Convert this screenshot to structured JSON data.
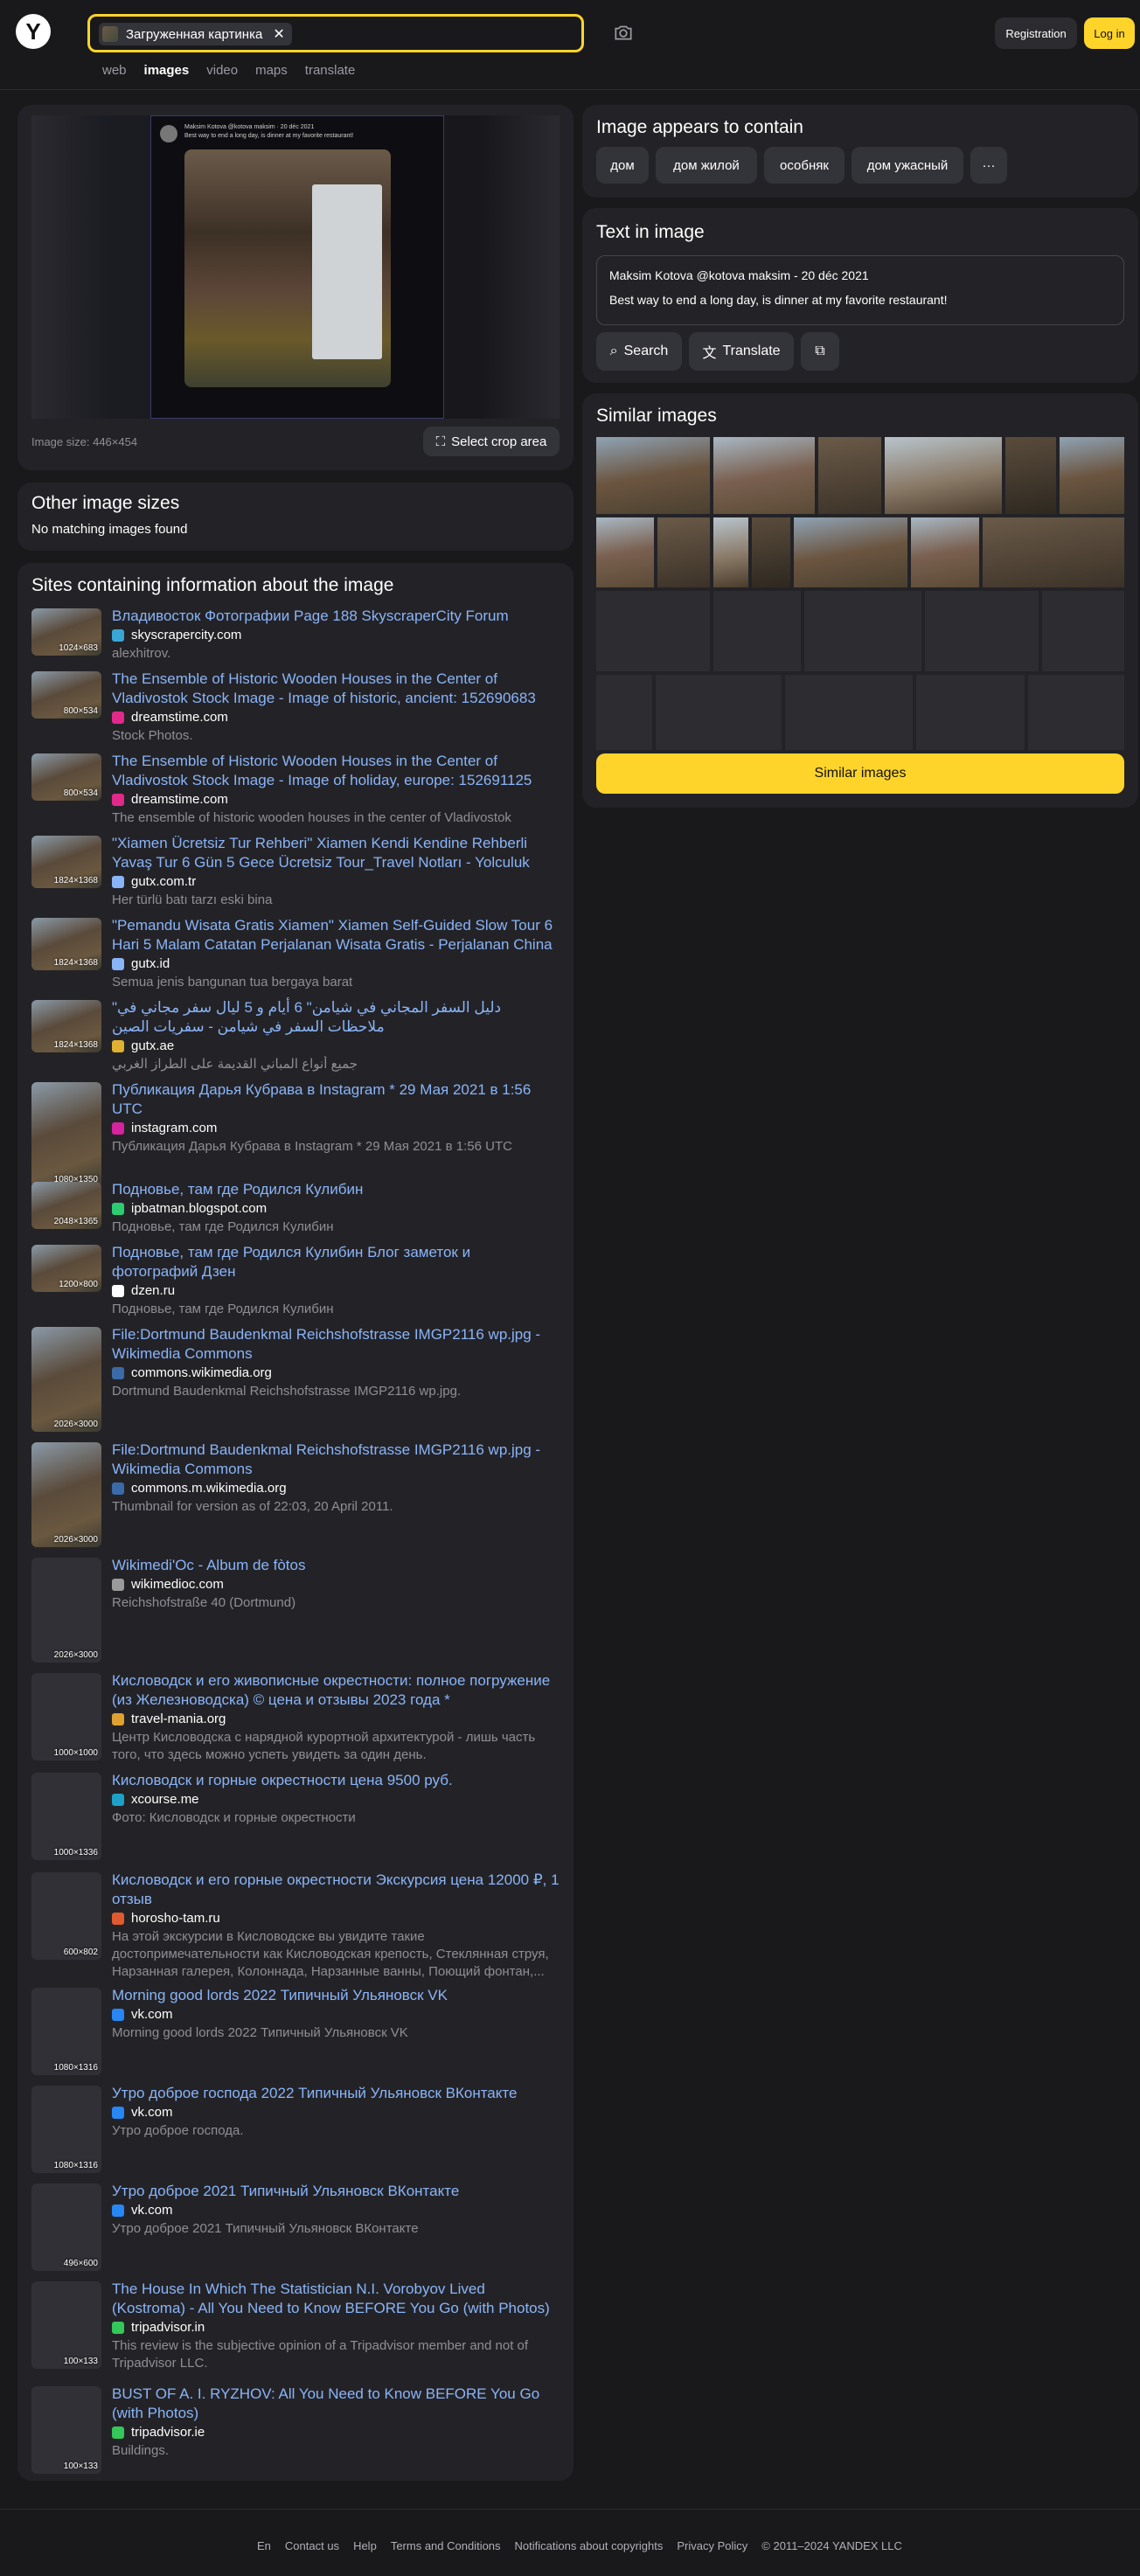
{
  "header": {
    "logo": "Y",
    "search_chip": "Загруженная картинка",
    "register_label": "Registration",
    "login_label": "Log in",
    "tabs": [
      "web",
      "images",
      "video",
      "maps",
      "translate"
    ]
  },
  "preview": {
    "tweet_author": "Maksim Kotova @kotova maksim · 20 déc 2021",
    "tweet_text": "Best way to end a long day, is dinner at my favorite restaurant!",
    "image_size": "Image size: 446×454",
    "crop_label": "Select crop area"
  },
  "other_sizes": {
    "title": "Other image sizes",
    "text": "No matching images found"
  },
  "sites": {
    "title": "Sites containing information about the image",
    "items": [
      {
        "size": "1024×683",
        "title": "Владивосток Фотографии Page 188 SkyscraperCity Forum",
        "domain": "skyscrapercity.com",
        "snippet": "alexhitrov.",
        "fav": "#38a7d6"
      },
      {
        "size": "800×534",
        "title": "The Ensemble of Historic Wooden Houses in the Center of Vladivostok Stock Image - Image of historic, ancient: 152690683",
        "domain": "dreamstime.com",
        "snippet": "Stock Photos.",
        "fav": "#e2298a"
      },
      {
        "size": "800×534",
        "title": "The Ensemble of Historic Wooden Houses in the Center of Vladivostok Stock Image - Image of holiday, europe: 152691125",
        "domain": "dreamstime.com",
        "snippet": "The ensemble of historic wooden houses in the center of Vladivostok",
        "fav": "#e2298a"
      },
      {
        "size": "1824×1368",
        "title": "\"Xiamen Ücretsiz Tur Rehberi\" Xiamen Kendi Kendine Rehberli Yavaş Tur 6 Gün 5 Gece Ücretsiz Tour_Travel Notları - Yolculuk",
        "domain": "gutx.com.tr",
        "snippet": "Her türlü batı tarzı eski bina",
        "fav": "#8ab4f8"
      },
      {
        "size": "1824×1368",
        "title": "\"Pemandu Wisata Gratis Xiamen\" Xiamen Self-Guided Slow Tour 6 Hari 5 Malam Catatan Perjalanan Wisata Gratis - Perjalanan China",
        "domain": "gutx.id",
        "snippet": "Semua jenis bangunan tua bergaya barat",
        "fav": "#8ab4f8"
      },
      {
        "size": "1824×1368",
        "title": "\"دليل السفر المجاني في شيامن\" 6 أيام و 5 ليال سفر مجاني في ملاحظات السفر في شيامن - سفريات الصين",
        "domain": "gutx.ae",
        "snippet": "جميع أنواع المباني القديمة على الطراز الغربي",
        "fav": "#e0b030"
      },
      {
        "size": "1080×1350",
        "title": "Публикация Дарья Кубрава в Instagram * 29 Мая 2021 в 1:56 UTC",
        "domain": "instagram.com",
        "snippet": "Публикация Дарья Кубрава в Instagram * 29 Мая 2021 в 1:56 UTC",
        "fav": "#d6249f"
      },
      {
        "size": "2048×1365",
        "title": "Подновье, там где Родился Кулибин",
        "domain": "ipbatman.blogspot.com",
        "snippet": "Подновье, там где Родился Кулибин",
        "fav": "#2ecc71"
      },
      {
        "size": "1200×800",
        "title": "Подновье, там где Родился Кулибин Блог заметок и фотографий Дзен",
        "domain": "dzen.ru",
        "snippet": "Подновье, там где Родился Кулибин",
        "fav": "#ffffff"
      },
      {
        "size": "2026×3000",
        "title": "File:Dortmund Baudenkmal Reichshofstrasse IMGP2116 wp.jpg - Wikimedia Commons",
        "domain": "commons.wikimedia.org",
        "snippet": "Dortmund Baudenkmal Reichshofstrasse IMGP2116 wp.jpg.",
        "fav": "#3b6aa8"
      },
      {
        "size": "2026×3000",
        "title": "File:Dortmund Baudenkmal Reichshofstrasse IMGP2116 wp.jpg - Wikimedia Commons",
        "domain": "commons.m.wikimedia.org",
        "snippet": "Thumbnail for version as of 22:03, 20 April 2011.",
        "fav": "#3b6aa8"
      },
      {
        "size": "2026×3000",
        "title": "Wikimedi'Oc - Album de fòtos",
        "domain": "wikimedioc.com",
        "snippet": "Reichshofstraße 40 (Dortmund)",
        "fav": "#9a9a9a"
      },
      {
        "size": "1000×1000",
        "title": "Кисловодск и его живописные окрестности: полное погружение (из Железноводска) © цена и отзывы 2023 года *",
        "domain": "travel-mania.org",
        "snippet": "Центр Кисловодска с нарядной курортной архитектурой - лишь часть того, что здесь можно успеть увидеть за один день.",
        "fav": "#e0a030"
      },
      {
        "size": "1000×1336",
        "title": "Кисловодск и горные окрестности цена 9500 руб.",
        "domain": "xcourse.me",
        "snippet": "Фото: Кисловодск и горные окрестности",
        "fav": "#1da1c8"
      },
      {
        "size": "600×802",
        "title": "Кисловодск и его горные окрестности Экскурсия цена 12000 ₽, 1 отзыв",
        "domain": "horosho-tam.ru",
        "snippet": "На этой экскурсии в Кисловодске вы увидите такие достопримечательности как Кисловодская крепость, Стеклянная струя, Нарзанная галерея, Колоннада, Нарзанные ванны, Поющий фонтан,...",
        "fav": "#e05a30"
      },
      {
        "size": "1080×1316",
        "title": "Morning good lords 2022 Типичный Ульяновск VK",
        "domain": "vk.com",
        "snippet": "Morning good lords 2022 Типичный Ульяновск VK",
        "fav": "#2787f5"
      },
      {
        "size": "1080×1316",
        "title": "Утро доброе господа 2022 Типичный Ульяновск ВКонтакте",
        "domain": "vk.com",
        "snippet": "Утро доброе господа.",
        "fav": "#2787f5"
      },
      {
        "size": "496×600",
        "title": "Утро доброе 2021 Типичный Ульяновск ВКонтакте",
        "domain": "vk.com",
        "snippet": "Утро доброе 2021 Типичный Ульяновск ВКонтакте",
        "fav": "#2787f5"
      },
      {
        "size": "100×133",
        "title": "The House In Which The Statistician N.I. Vorobyov Lived (Kostroma) - All You Need to Know BEFORE You Go (with Photos)",
        "domain": "tripadvisor.in",
        "snippet": "This review is the subjective opinion of a Tripadvisor member and not of Tripadvisor LLC.",
        "fav": "#34c759"
      },
      {
        "size": "100×133",
        "title": "BUST OF A. I. RYZHOV: All You Need to Know BEFORE You Go (with Photos)",
        "domain": "tripadvisor.ie",
        "snippet": "Buildings.",
        "fav": "#34c759"
      }
    ]
  },
  "contains": {
    "title": "Image appears to contain",
    "tags": [
      "дом",
      "дом жилой",
      "особняк",
      "дом ужасный"
    ],
    "more": "···"
  },
  "text_in_image": {
    "title": "Text in image",
    "line1": "Maksim Kotova @kotova maksim - 20 déc 2021",
    "line2": "Best way to end a long day, is dinner at my favorite restaurant!",
    "search_label": "Search",
    "translate_label": "Translate"
  },
  "similar": {
    "title": "Similar images",
    "button_label": "Similar images"
  },
  "footer": {
    "links": [
      "En",
      "Contact us",
      "Help",
      "Terms and Conditions",
      "Notifications about copyrights",
      "Privacy Policy",
      "© 2011–2024 YANDEX LLC"
    ]
  }
}
